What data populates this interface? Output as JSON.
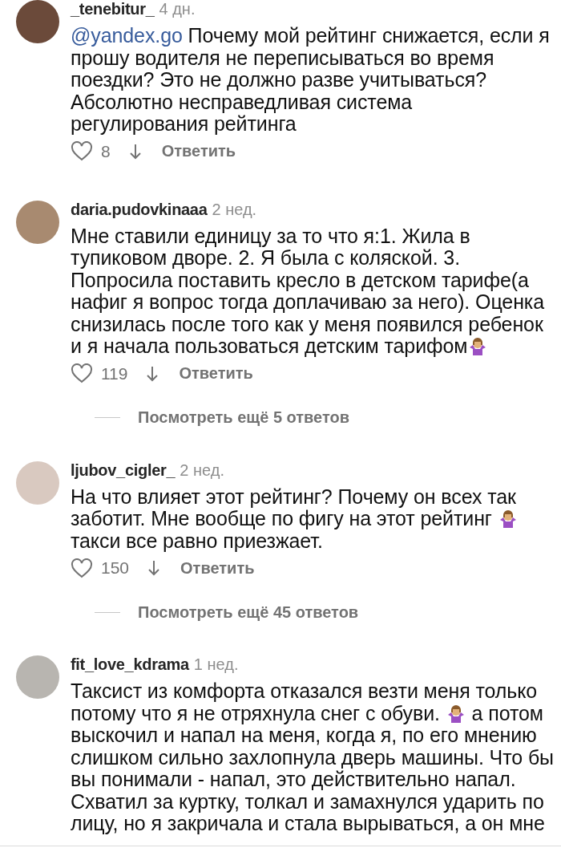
{
  "comments": [
    {
      "username": "_tenebitur_",
      "time": "4 дн.",
      "body": [
        {
          "kind": "mention",
          "text": "@yandex.go"
        },
        {
          "kind": "text",
          "text": " Почему мой рейтинг снижается, если я\nпрошу водителя не переписываться во время\nпоездки? Это не должно разве учитываться?\nАбсолютно несправедливая система\nрегулирования рейтинга"
        }
      ],
      "likes": "8",
      "reply": "Ответить"
    },
    {
      "username": "daria.pudovkinaaa",
      "time": "2 нед.",
      "body": [
        {
          "kind": "text",
          "text": "Мне ставили единицу за то что я:1. Жила в\nтупиковом дворе. 2. Я была с коляской. 3.\nПопросила поставить кресло в детском тарифе(а\nнафиг я вопрос тогда доплачиваю за него). Оценка\nснизилась после того как у меня появился ребенок\nи я начала пользоваться детским тарифом"
        },
        {
          "kind": "emoji"
        }
      ],
      "likes": "119",
      "reply": "Ответить",
      "more_replies": "Посмотреть ещё 5 ответов"
    },
    {
      "username": "ljubov_cigler_",
      "time": "2 нед.",
      "body": [
        {
          "kind": "text",
          "text": "На что влияет этот рейтинг? Почему он всех так\nзаботит. Мне вообще по фигу на этот рейтинг "
        },
        {
          "kind": "emoji"
        },
        {
          "kind": "text",
          "text": "\nтакси все равно приезжает."
        }
      ],
      "likes": "150",
      "reply": "Ответить",
      "more_replies": "Посмотреть ещё 45 ответов"
    },
    {
      "username": "fit_love_kdrama",
      "time": "1 нед.",
      "body": [
        {
          "kind": "text",
          "text": "Таксист из комфорта отказался везти меня только\nпотому что я не отряхнула снег с обуви. "
        },
        {
          "kind": "emoji"
        },
        {
          "kind": "text",
          "text": " а потом\nвыскочил и напал на меня, когда я, по его мнению\nслишком сильно захлопнула дверь машины. Что бы\nвы понимали - напал, это действительно напал.\nСхватил за куртку, толкал и замахнулся ударить по\nлицу, но я закричала и стала вырываться, а он мне"
        }
      ]
    }
  ]
}
